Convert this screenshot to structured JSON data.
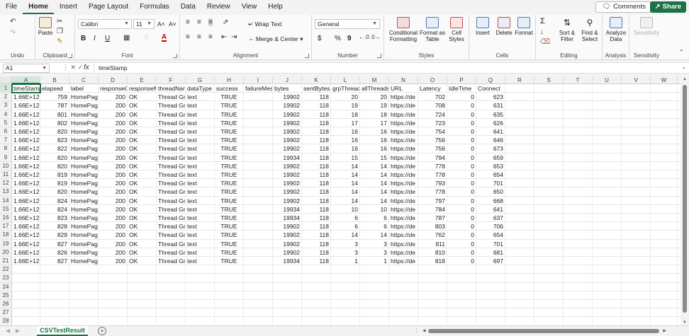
{
  "menu": [
    "File",
    "Home",
    "Insert",
    "Page Layout",
    "Formulas",
    "Data",
    "Review",
    "View",
    "Help"
  ],
  "active_menu": "Home",
  "header_buttons": {
    "comments": "Comments",
    "share": "Share"
  },
  "ribbon": {
    "undo": {
      "label": "Undo"
    },
    "clipboard": {
      "label": "Clipboard",
      "paste": "Paste"
    },
    "font": {
      "label": "Font",
      "family": "Calibri",
      "size": "11",
      "grow": "A˄",
      "shrink": "A˅",
      "bold": "B",
      "italic": "I",
      "underline": "U",
      "font_color": "A"
    },
    "alignment": {
      "label": "Alignment",
      "wrap_text": "Wrap Text",
      "merge_center": "Merge & Center"
    },
    "number": {
      "label": "Number",
      "format": "General",
      "currency": "$",
      "percent": "%",
      "comma": "9"
    },
    "styles": {
      "label": "Styles",
      "conditional": "Conditional Formatting",
      "format_table": "Format as Table",
      "cell_styles": "Cell Styles"
    },
    "cells": {
      "label": "Cells",
      "insert": "Insert",
      "delete": "Delete",
      "format": "Format"
    },
    "editing": {
      "label": "Editing",
      "sort_filter": "Sort & Filter",
      "find_select": "Find & Select",
      "sum": "Σ"
    },
    "analysis": {
      "label": "Analysis",
      "analyze_data": "Analyze Data"
    },
    "sensitivity": {
      "label": "Sensitivity",
      "button": "Sensitivity"
    }
  },
  "formula_bar": {
    "name_box": "A1",
    "content": "timeStamp",
    "fx": "fx"
  },
  "columns": [
    "A",
    "B",
    "C",
    "D",
    "E",
    "F",
    "G",
    "H",
    "I",
    "J",
    "K",
    "L",
    "M",
    "N",
    "O",
    "P",
    "Q",
    "R",
    "S",
    "T",
    "U",
    "V",
    "W"
  ],
  "header_row": [
    "timeStamp",
    "elapsed",
    "label",
    "responseCode",
    "responseMessage",
    "threadName",
    "dataType",
    "success",
    "failureMessage",
    "bytes",
    "sentBytes",
    "grpThreads",
    "allThreads",
    "URL",
    "Latency",
    "IdleTime",
    "Connect"
  ],
  "header_display": [
    "timeStamp",
    "elapsed",
    "label",
    "responseC",
    "responseM",
    "threadNar",
    "dataType",
    "success",
    "failureMes",
    "bytes",
    "sentBytes",
    "grpThread:",
    "allThreads",
    "URL",
    "Latency",
    "IdleTime",
    "Connect"
  ],
  "rows": [
    [
      "1.66E+12",
      "759",
      "HomePage",
      "200",
      "OK",
      "Thread Gr",
      "text",
      "TRUE",
      "",
      "19902",
      "118",
      "20",
      "20",
      "https://de",
      "702",
      "0",
      "623"
    ],
    [
      "1.66E+12",
      "787",
      "HomePage",
      "200",
      "OK",
      "Thread Gr",
      "text",
      "TRUE",
      "",
      "19902",
      "118",
      "19",
      "19",
      "https://de",
      "708",
      "0",
      "631"
    ],
    [
      "1.66E+12",
      "801",
      "HomePage",
      "200",
      "OK",
      "Thread Gr",
      "text",
      "TRUE",
      "",
      "19902",
      "118",
      "18",
      "18",
      "https://de",
      "724",
      "0",
      "635"
    ],
    [
      "1.66E+12",
      "802",
      "HomePage",
      "200",
      "OK",
      "Thread Gr",
      "text",
      "TRUE",
      "",
      "19902",
      "118",
      "17",
      "17",
      "https://de",
      "723",
      "0",
      "626"
    ],
    [
      "1.66E+12",
      "820",
      "HomePage",
      "200",
      "OK",
      "Thread Gr",
      "text",
      "TRUE",
      "",
      "19902",
      "118",
      "16",
      "16",
      "https://de",
      "754",
      "0",
      "641"
    ],
    [
      "1.66E+12",
      "823",
      "HomePage",
      "200",
      "OK",
      "Thread Gr",
      "text",
      "TRUE",
      "",
      "19902",
      "118",
      "16",
      "16",
      "https://de",
      "756",
      "0",
      "646"
    ],
    [
      "1.66E+12",
      "822",
      "HomePage",
      "200",
      "OK",
      "Thread Gr",
      "text",
      "TRUE",
      "",
      "19902",
      "118",
      "16",
      "16",
      "https://de",
      "756",
      "0",
      "673"
    ],
    [
      "1.66E+12",
      "820",
      "HomePage",
      "200",
      "OK",
      "Thread Gr",
      "text",
      "TRUE",
      "",
      "19934",
      "118",
      "15",
      "15",
      "https://de",
      "794",
      "0",
      "659"
    ],
    [
      "1.66E+12",
      "820",
      "HomePage",
      "200",
      "OK",
      "Thread Gr",
      "text",
      "TRUE",
      "",
      "19902",
      "118",
      "14",
      "14",
      "https://de",
      "778",
      "0",
      "653"
    ],
    [
      "1.66E+12",
      "819",
      "HomePage",
      "200",
      "OK",
      "Thread Gr",
      "text",
      "TRUE",
      "",
      "19902",
      "118",
      "14",
      "14",
      "https://de",
      "778",
      "0",
      "654"
    ],
    [
      "1.66E+12",
      "819",
      "HomePage",
      "200",
      "OK",
      "Thread Gr",
      "text",
      "TRUE",
      "",
      "19902",
      "118",
      "14",
      "14",
      "https://de",
      "793",
      "0",
      "701"
    ],
    [
      "1.66E+12",
      "820",
      "HomePage",
      "200",
      "OK",
      "Thread Gr",
      "text",
      "TRUE",
      "",
      "19902",
      "118",
      "14",
      "14",
      "https://de",
      "778",
      "0",
      "650"
    ],
    [
      "1.66E+12",
      "824",
      "HomePage",
      "200",
      "OK",
      "Thread Gr",
      "text",
      "TRUE",
      "",
      "19902",
      "118",
      "14",
      "14",
      "https://de",
      "797",
      "0",
      "668"
    ],
    [
      "1.66E+12",
      "824",
      "HomePage",
      "200",
      "OK",
      "Thread Gr",
      "text",
      "TRUE",
      "",
      "19934",
      "118",
      "10",
      "10",
      "https://de",
      "784",
      "0",
      "641"
    ],
    [
      "1.66E+12",
      "823",
      "HomePage",
      "200",
      "OK",
      "Thread Gr",
      "text",
      "TRUE",
      "",
      "19934",
      "118",
      "6",
      "6",
      "https://de",
      "787",
      "0",
      "637"
    ],
    [
      "1.66E+12",
      "828",
      "HomePage",
      "200",
      "OK",
      "Thread Gr",
      "text",
      "TRUE",
      "",
      "19902",
      "118",
      "6",
      "6",
      "https://de",
      "803",
      "0",
      "706"
    ],
    [
      "1.66E+12",
      "829",
      "HomePage",
      "200",
      "OK",
      "Thread Gr",
      "text",
      "TRUE",
      "",
      "19902",
      "118",
      "14",
      "14",
      "https://de",
      "762",
      "0",
      "654"
    ],
    [
      "1.66E+12",
      "827",
      "HomePage",
      "200",
      "OK",
      "Thread Gr",
      "text",
      "TRUE",
      "",
      "19902",
      "118",
      "3",
      "3",
      "https://de",
      "811",
      "0",
      "701"
    ],
    [
      "1.66E+12",
      "826",
      "HomePage",
      "200",
      "OK",
      "Thread Gr",
      "text",
      "TRUE",
      "",
      "19902",
      "118",
      "3",
      "3",
      "https://de",
      "810",
      "0",
      "681"
    ],
    [
      "1.66E+12",
      "827",
      "HomePage",
      "200",
      "OK",
      "Thread Gr",
      "text",
      "TRUE",
      "",
      "19934",
      "118",
      "1",
      "1",
      "https://de",
      "818",
      "0",
      "697"
    ]
  ],
  "row_numbers": [
    "1",
    "2",
    "3",
    "4",
    "5",
    "6",
    "7",
    "8",
    "9",
    "10",
    "11",
    "12",
    "13",
    "14",
    "15",
    "16",
    "17",
    "18",
    "19",
    "20",
    "21",
    "22",
    "23",
    "24",
    "25",
    "26",
    "27",
    "28"
  ],
  "sheet_tab": "CSVTestResult",
  "add_sheet": "+",
  "accent_color": "#1e7145"
}
